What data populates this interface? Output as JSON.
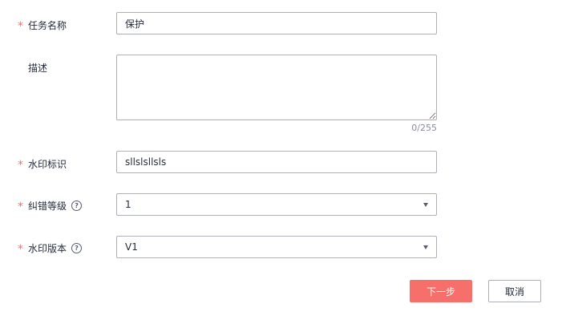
{
  "form": {
    "task_name": {
      "label": "任务名称",
      "required_mark": "*",
      "value": "保护"
    },
    "description": {
      "label": "描述",
      "value": "",
      "counter": "0/255"
    },
    "watermark_id": {
      "label": "水印标识",
      "required_mark": "*",
      "value": "sllslsllsls"
    },
    "ecc_level": {
      "label": "纠错等级",
      "required_mark": "*",
      "help_icon": "question-circle-icon",
      "help_glyph": "?",
      "selected": "1"
    },
    "watermark_version": {
      "label": "水印版本",
      "required_mark": "*",
      "help_icon": "question-circle-icon",
      "help_glyph": "?",
      "selected": "V1"
    }
  },
  "actions": {
    "next_label": "下一步",
    "cancel_label": "取消"
  },
  "colors": {
    "required": "#f66f6a",
    "primary_button": "#f66f6a",
    "border": "#adb0b8",
    "text": "#252b3a",
    "muted": "#8a8e99"
  }
}
